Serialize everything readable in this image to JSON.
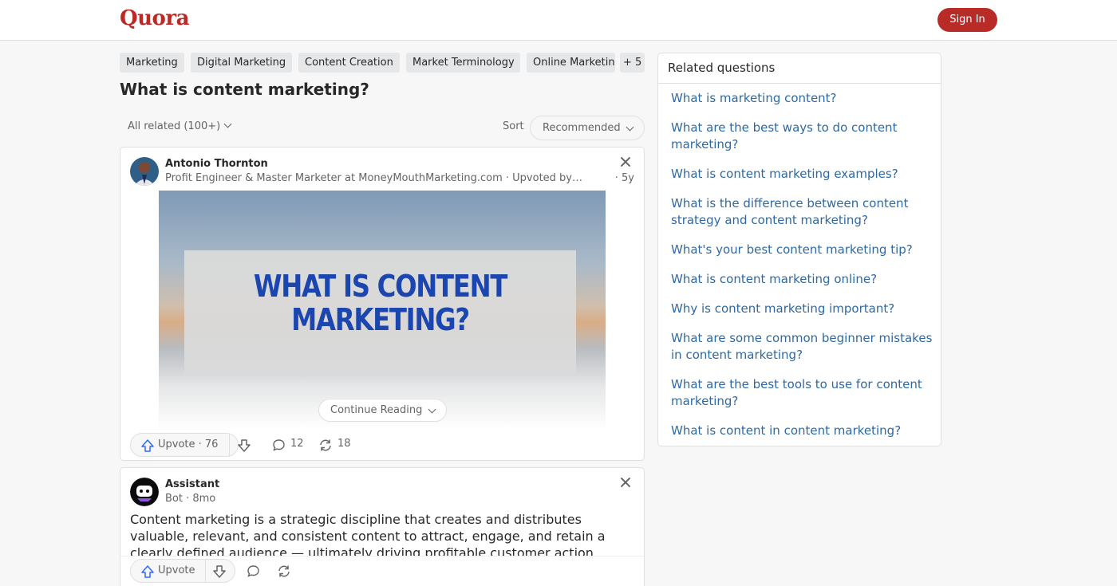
{
  "header": {
    "logo": "Quora",
    "signin_label": "Sign In"
  },
  "topics": [
    "Marketing",
    "Digital Marketing",
    "Content Creation",
    "Market Terminology",
    "Online Marketing",
    "+ 5"
  ],
  "question": {
    "title": "What is content marketing?"
  },
  "filters": {
    "all_related": "All related (100+)",
    "sort_label": "Sort",
    "sort_value": "Recommended"
  },
  "answers": [
    {
      "author": "Antonio Thornton",
      "credential": "Profit Engineer & Master Marketer at MoneyMouthMarketing.com · Upvoted by…",
      "time": "· 5y",
      "image_text": [
        "WHAT IS CONTENT",
        "MARKETING?"
      ],
      "continue_label": "Continue Reading",
      "upvote_label": "Upvote · 76",
      "comments": "12",
      "shares": "18"
    },
    {
      "author": "Assistant",
      "credential": "Bot · 8mo",
      "text": "Content marketing is a strategic discipline that creates and distributes valuable, relevant, and consistent content to attract, engage, and retain a clearly defined audience — ultimately driving profitable customer action.",
      "upvote_label": "Upvote"
    }
  ],
  "related": {
    "title": "Related questions",
    "items": [
      "What is marketing content?",
      "What are the best ways to do content marketing?",
      "What is content marketing examples?",
      "What is the difference between content strategy and content marketing?",
      "What's your best content marketing tip?",
      "What is content marketing online?",
      "Why is content marketing important?",
      "What are some common beginner mistakes in content marketing?",
      "What are the best tools to use for content marketing?",
      "What is content in content marketing?"
    ]
  },
  "colors": {
    "brand": "#b92b27",
    "link": "#2e69a3",
    "hero_text": "#1b46b0"
  }
}
